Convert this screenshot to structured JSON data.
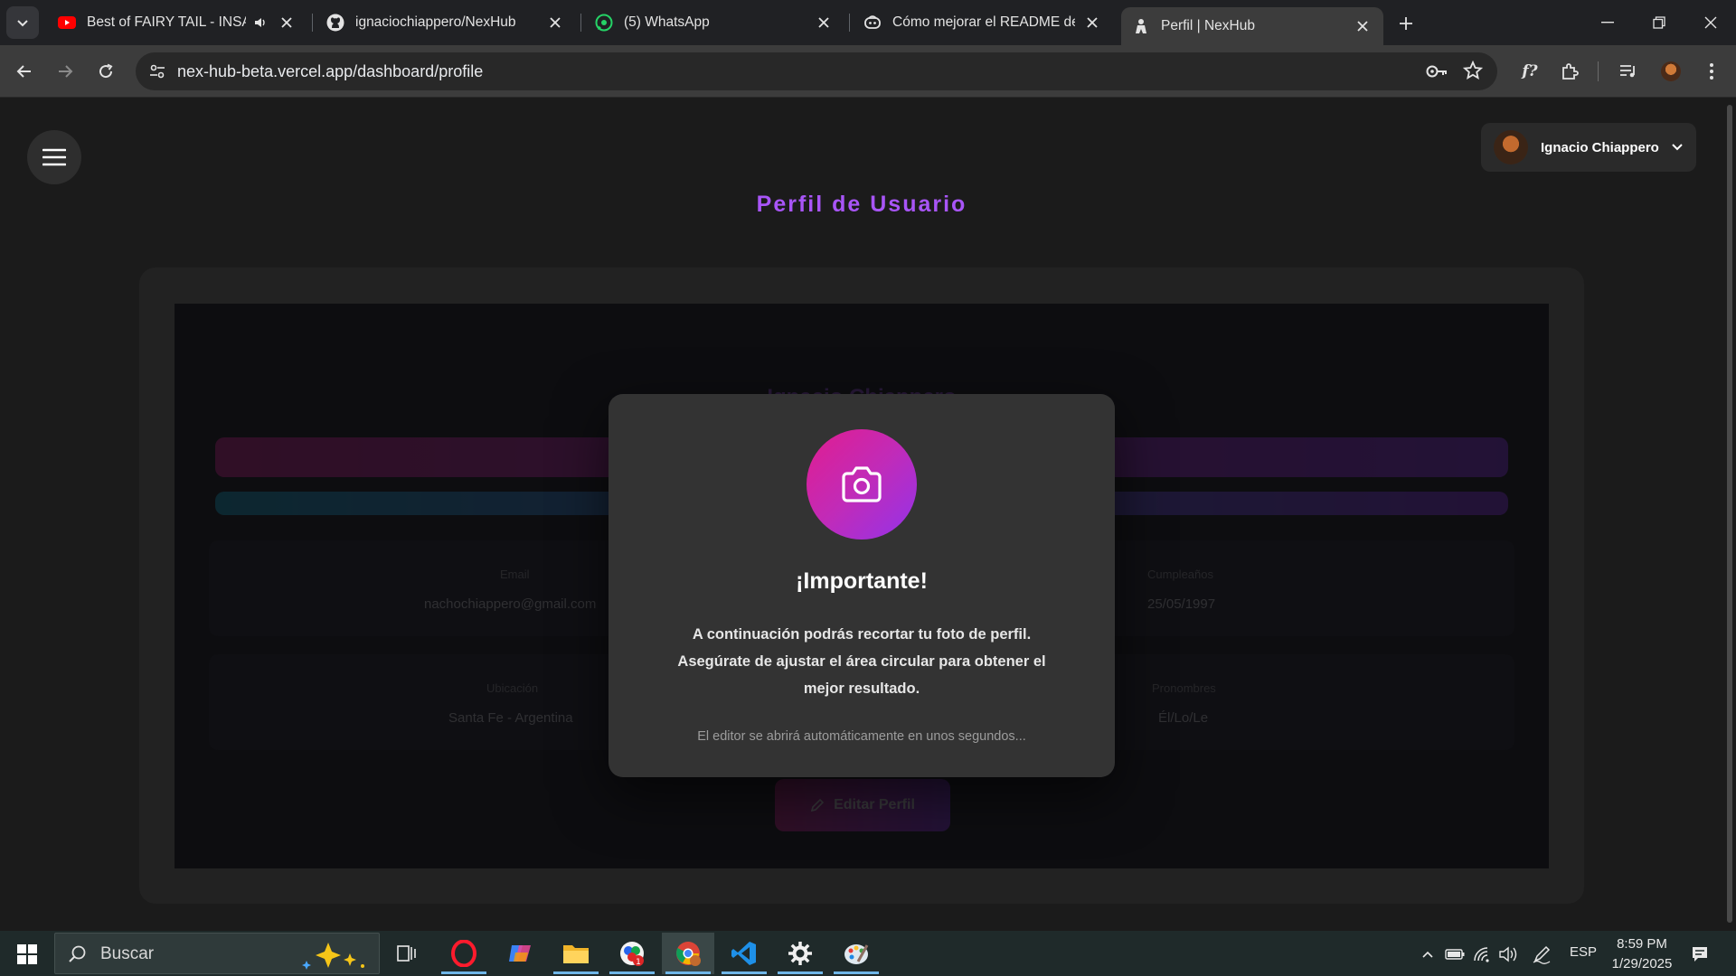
{
  "browser": {
    "tabs": [
      {
        "title": "Best of FAIRY TAIL - INSANE",
        "icon": "youtube-icon",
        "audio": true
      },
      {
        "title": "ignaciochiappero/NexHub",
        "icon": "github-icon"
      },
      {
        "title": "(5) WhatsApp",
        "icon": "whatsapp-icon"
      },
      {
        "title": "Cómo mejorar el README de un",
        "icon": "copilot-icon"
      },
      {
        "title": "Perfil | NexHub",
        "icon": "nexhub-icon",
        "active": true
      }
    ],
    "url": "nex-hub-beta.vercel.app/dashboard/profile"
  },
  "page": {
    "title": "Perfil de Usuario",
    "user_name": "Ignacio Chiappero"
  },
  "background_profile": {
    "name": "Ignacio Chiappero",
    "fields": [
      {
        "label": "Email",
        "value": "nachochiappero@gmail.com"
      },
      {
        "label": "Cumpleaños",
        "value": "25/05/1997"
      },
      {
        "label": "Ubicación",
        "value": "Santa Fe - Argentina"
      },
      {
        "label": "Pronombres",
        "value": "Él/Lo/Le"
      }
    ],
    "edit_button": "Editar Perfil"
  },
  "modal": {
    "title": "¡Importante!",
    "line1": "A continuación podrás recortar tu foto de perfil.",
    "line2": "Asegúrate de ajustar el área circular para obtener el",
    "line3": "mejor resultado.",
    "note": "El editor se abrirá automáticamente en unos segundos..."
  },
  "taskbar": {
    "search_placeholder": "Buscar",
    "language": "ESP",
    "time": "8:59 PM",
    "date": "1/29/2025"
  },
  "colors": {
    "accent_purple": "#a855f7",
    "gradient_pink": "#e11d8f",
    "gradient_violet": "#9333ea"
  }
}
